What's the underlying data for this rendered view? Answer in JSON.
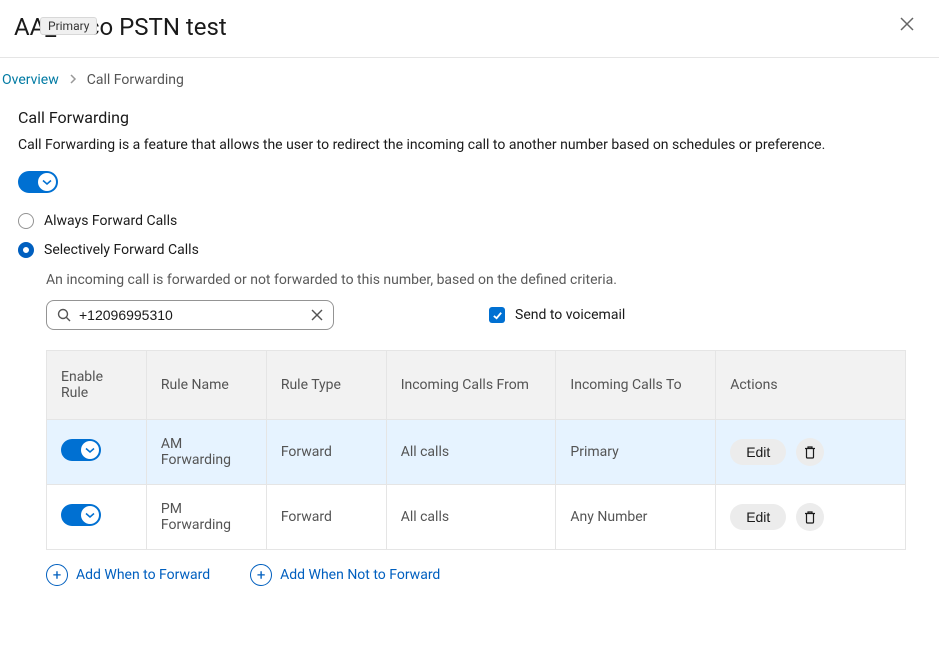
{
  "header": {
    "title": "AA_cisco PSTN test",
    "badge": "Primary"
  },
  "breadcrumb": {
    "link": "Overview",
    "current": "Call Forwarding"
  },
  "section": {
    "title": "Call Forwarding",
    "description": "Call Forwarding is a feature that allows the user to redirect the incoming call to another number based on schedules or preference."
  },
  "radios": {
    "always": "Always Forward Calls",
    "selective": "Selectively Forward Calls"
  },
  "selective": {
    "description": "An incoming call is forwarded or not forwarded to this number, based on the defined criteria.",
    "phone": "+12096995310",
    "voicemail_label": "Send to voicemail"
  },
  "table": {
    "headers": {
      "enable": "Enable Rule",
      "name": "Rule Name",
      "type": "Rule Type",
      "from": "Incoming Calls From",
      "to": "Incoming Calls To",
      "actions": "Actions"
    },
    "rows": [
      {
        "name": "AM Forwarding",
        "type": "Forward",
        "from": "All calls",
        "to": "Primary",
        "edit": "Edit"
      },
      {
        "name": "PM Forwarding",
        "type": "Forward",
        "from": "All calls",
        "to": "Any Number",
        "edit": "Edit"
      }
    ]
  },
  "add_links": {
    "forward": "Add When to Forward",
    "not_forward": "Add When Not to Forward"
  }
}
